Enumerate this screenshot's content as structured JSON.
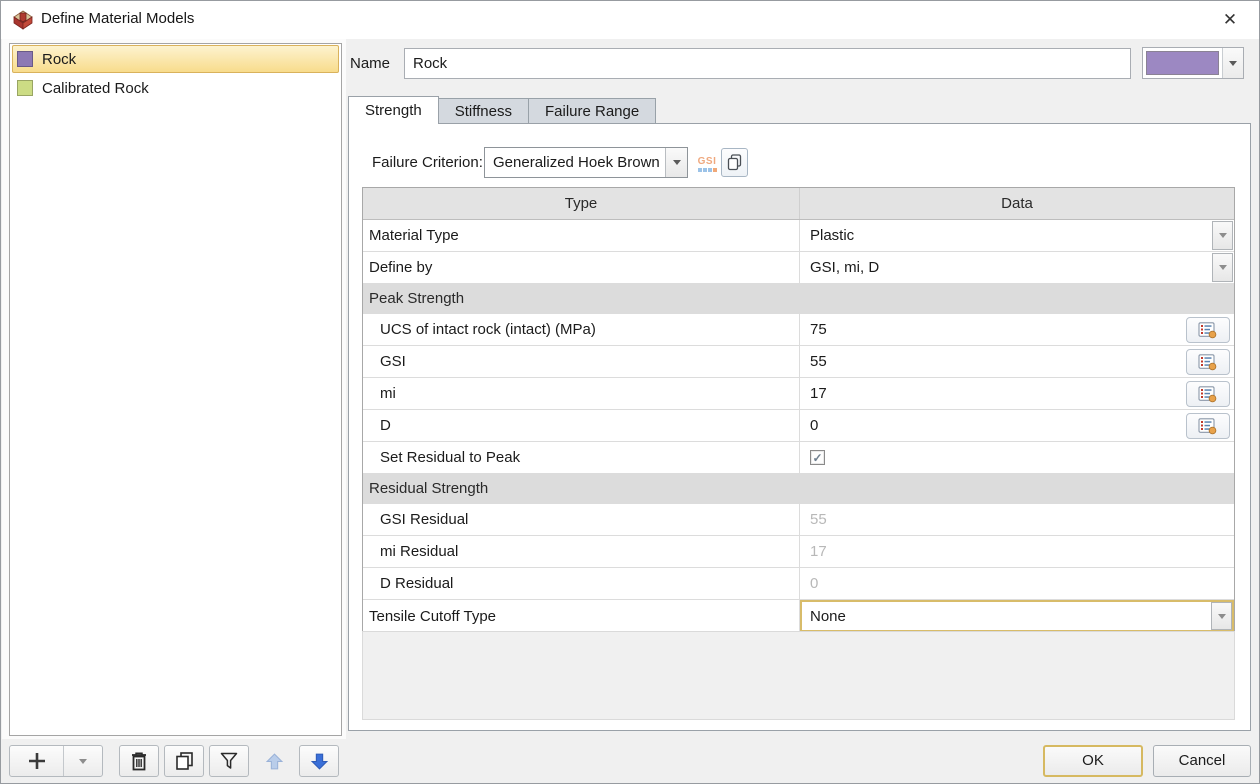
{
  "window": {
    "title": "Define Material Models",
    "close_glyph": "✕"
  },
  "materials_list": {
    "items": [
      {
        "name": "Rock",
        "color": "#8d79b4",
        "selected": true
      },
      {
        "name": "Calibrated Rock",
        "color": "#ccdc84",
        "selected": false
      }
    ]
  },
  "name_row": {
    "label": "Name",
    "value": "Rock",
    "swatch_color": "#9c88c2"
  },
  "tabs": [
    {
      "label": "Strength",
      "active": true
    },
    {
      "label": "Stiffness",
      "active": false
    },
    {
      "label": "Failure Range",
      "active": false
    }
  ],
  "failure_criterion": {
    "label": "Failure Criterion:",
    "selected": "Generalized Hoek Brown"
  },
  "gsi_button": {
    "text": "GSI",
    "dot_colors": [
      "#9cc3e8",
      "#9cc3e8",
      "#9cc3e8",
      "#f0a878"
    ]
  },
  "property_table": {
    "headers": [
      "Type",
      "Data"
    ],
    "rows": [
      {
        "kind": "row",
        "type": "Material Type",
        "data": "Plastic",
        "control": "dropdown"
      },
      {
        "kind": "row",
        "type": "Define by",
        "data": "GSI, mi, D",
        "control": "dropdown"
      },
      {
        "kind": "section",
        "type": "Peak Strength"
      },
      {
        "kind": "row",
        "type": "UCS of intact rock (intact) (MPa)",
        "data": "75",
        "control": "stat",
        "indent": true
      },
      {
        "kind": "row",
        "type": "GSI",
        "data": "55",
        "control": "stat",
        "indent": true
      },
      {
        "kind": "row",
        "type": "mi",
        "data": "17",
        "control": "stat",
        "indent": true
      },
      {
        "kind": "row",
        "type": "D",
        "data": "0",
        "control": "stat",
        "indent": true
      },
      {
        "kind": "row",
        "type": "Set Residual to Peak",
        "data": "",
        "control": "checkbox",
        "checked": true,
        "indent": true
      },
      {
        "kind": "section",
        "type": "Residual Strength"
      },
      {
        "kind": "row",
        "type": "GSI Residual",
        "data": "55",
        "disabled": true,
        "indent": true
      },
      {
        "kind": "row",
        "type": "mi Residual",
        "data": "17",
        "disabled": true,
        "indent": true
      },
      {
        "kind": "row",
        "type": "D Residual",
        "data": "0",
        "disabled": true,
        "indent": true
      },
      {
        "kind": "row",
        "type": "Tensile Cutoff Type",
        "data": "None",
        "control": "dropdown",
        "focused": true
      }
    ]
  },
  "toolbar": {
    "buttons": [
      {
        "name": "add-material-button",
        "icon": "plus",
        "split": true
      },
      {
        "name": "delete-material-button",
        "icon": "trash"
      },
      {
        "name": "copy-material-button",
        "icon": "duplicate"
      },
      {
        "name": "filter-materials-button",
        "icon": "filter"
      },
      {
        "name": "move-up-button",
        "icon": "arrow-up",
        "disabled": true
      },
      {
        "name": "move-down-button",
        "icon": "arrow-down"
      }
    ]
  },
  "footer": {
    "ok_label": "OK",
    "cancel_label": "Cancel"
  },
  "colors": {
    "selection_gold": "#f8dc8c",
    "focus_gold": "#d6b961",
    "arrow_blue": "#3a6fd8"
  }
}
